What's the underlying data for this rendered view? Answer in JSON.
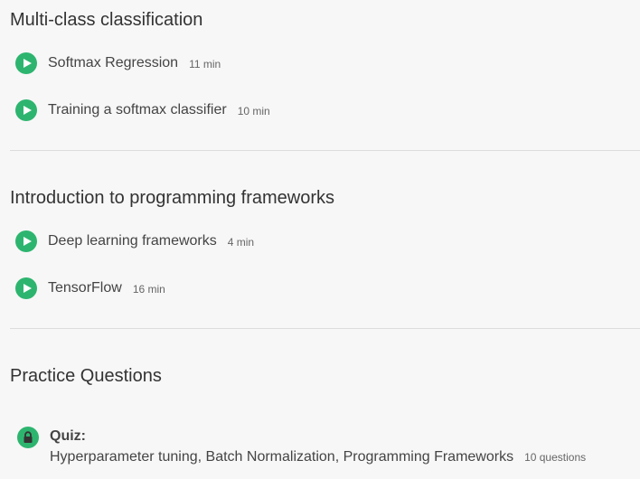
{
  "sections": [
    {
      "title": "Multi-class classification",
      "items": [
        {
          "title": "Softmax Regression",
          "duration": "11 min"
        },
        {
          "title": "Training a softmax classifier",
          "duration": "10 min"
        }
      ]
    },
    {
      "title": "Introduction to programming frameworks",
      "items": [
        {
          "title": "Deep learning frameworks",
          "duration": "4 min"
        },
        {
          "title": "TensorFlow",
          "duration": "16 min"
        }
      ]
    },
    {
      "title": "Practice Questions",
      "quiz": {
        "label": "Quiz:",
        "title": "Hyperparameter tuning, Batch Normalization, Programming Frameworks",
        "count": "10 questions",
        "icon": "lock-icon"
      }
    }
  ],
  "icons": {
    "video": "play-icon",
    "locked": "lock-icon"
  },
  "colors": {
    "accent": "#2db56f",
    "background": "#f7f7f7",
    "divider": "#dcdcdc"
  }
}
